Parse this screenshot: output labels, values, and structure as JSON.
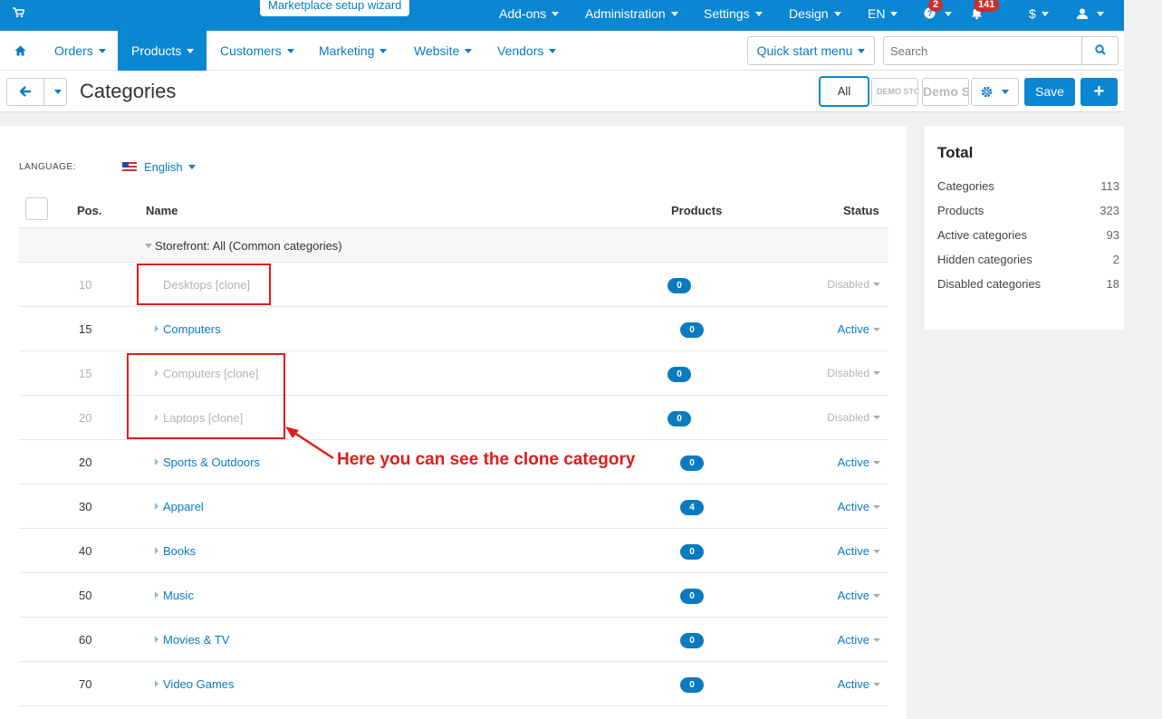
{
  "topbar": {
    "wizard_label": "Marketplace setup wizard",
    "items": [
      "Add-ons",
      "Administration",
      "Settings",
      "Design",
      "EN"
    ],
    "help_badge": "2",
    "notifications_badge": "141",
    "currency": "$"
  },
  "nav": {
    "items": [
      "Orders",
      "Products",
      "Customers",
      "Marketing",
      "Website",
      "Vendors"
    ],
    "active": "Products",
    "quick_start": "Quick start menu",
    "search_placeholder": "Search"
  },
  "toolbar": {
    "title": "Categories",
    "all_label": "All",
    "store1_label": "DEMO STORE",
    "store2_label": "Demo Store",
    "save_label": "Save",
    "add_label": "+"
  },
  "main": {
    "language_label": "LANGUAGE:",
    "language_value": "English",
    "columns": {
      "pos": "Pos.",
      "name": "Name",
      "products": "Products",
      "status": "Status"
    },
    "group": "Storefront: All (Common categories)",
    "rows": [
      {
        "pos": "10",
        "name": "Desktops [clone]",
        "products": "0",
        "status": "Disabled"
      },
      {
        "pos": "15",
        "name": "Computers",
        "products": "0",
        "status": "Active"
      },
      {
        "pos": "15",
        "name": "Computers [clone]",
        "products": "0",
        "status": "Disabled"
      },
      {
        "pos": "20",
        "name": "Laptops [clone]",
        "products": "0",
        "status": "Disabled"
      },
      {
        "pos": "20",
        "name": "Sports & Outdoors",
        "products": "0",
        "status": "Active"
      },
      {
        "pos": "30",
        "name": "Apparel",
        "products": "4",
        "status": "Active"
      },
      {
        "pos": "40",
        "name": "Books",
        "products": "0",
        "status": "Active"
      },
      {
        "pos": "50",
        "name": "Music",
        "products": "0",
        "status": "Active"
      },
      {
        "pos": "60",
        "name": "Movies & TV",
        "products": "0",
        "status": "Active"
      },
      {
        "pos": "70",
        "name": "Video Games",
        "products": "0",
        "status": "Active"
      }
    ]
  },
  "annotation": {
    "text": "Here you can see the clone category",
    "color": "#e01b1b"
  },
  "sidebar": {
    "title": "Total",
    "stats": [
      {
        "label": "Categories",
        "value": "113"
      },
      {
        "label": "Products",
        "value": "323"
      },
      {
        "label": "Active categories",
        "value": "93"
      },
      {
        "label": "Hidden categories",
        "value": "2"
      },
      {
        "label": "Disabled categories",
        "value": "18"
      }
    ]
  },
  "colors": {
    "brand": "#0a86d2",
    "link": "#0a7bc1",
    "annotation": "#e01b1b"
  }
}
